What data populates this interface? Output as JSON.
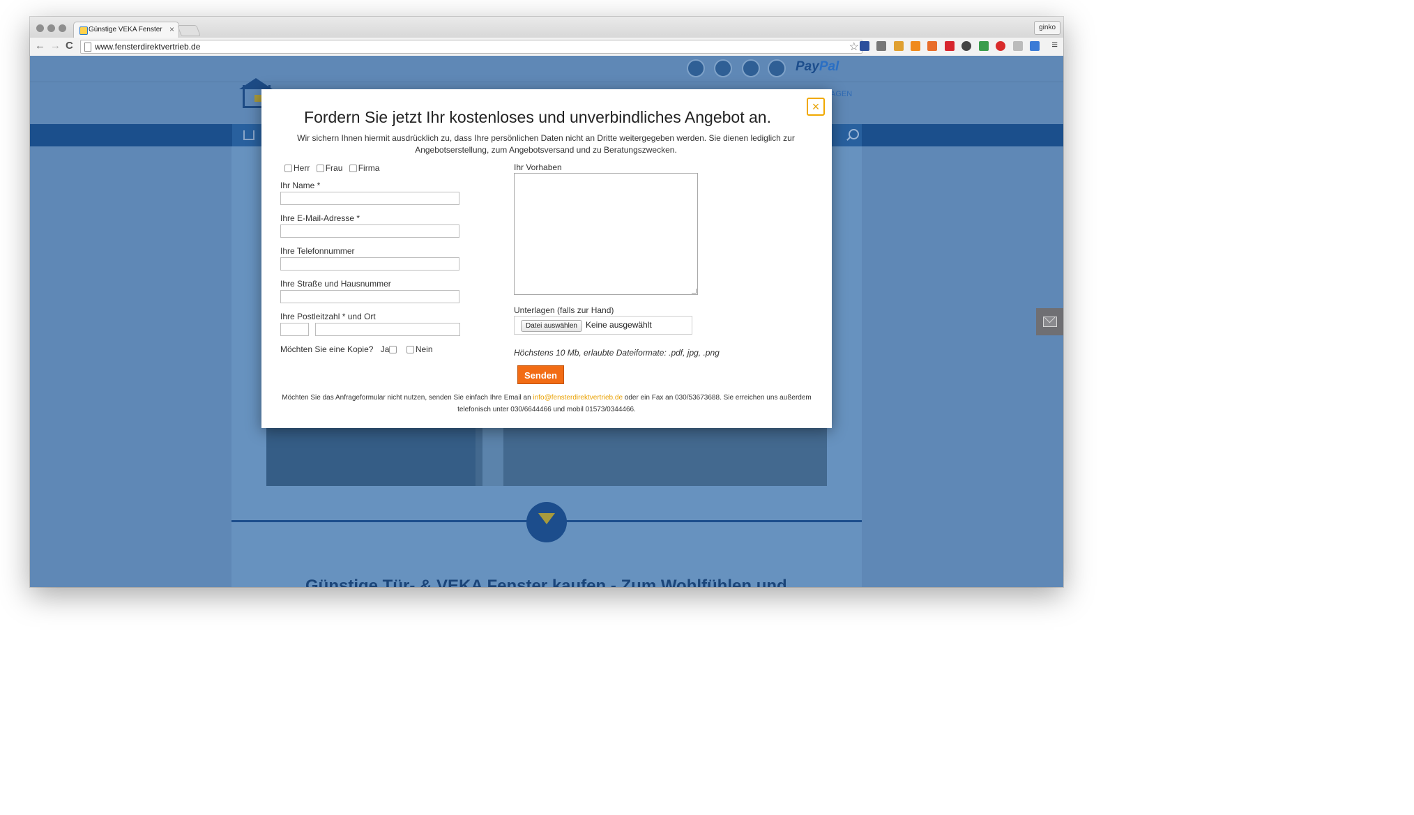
{
  "browser": {
    "tab_title": "Günstige VEKA Fenster ka",
    "tab_close": "×",
    "profile": "ginko",
    "url": "www.fensterdirektvertrieb.de",
    "back": "←",
    "forward": "→",
    "reload": "C",
    "bookmark_star": "☆",
    "menu": "≡"
  },
  "site": {
    "paypal_pay": "Pay",
    "paypal_pal": "Pal",
    "nav_right": "AGEN",
    "headline": "Günstige Tür- & VEKA Fenster kaufen - Zum Wohlfühlen und"
  },
  "modal": {
    "close": "×",
    "title": "Fordern Sie jetzt Ihr kostenloses und unverbindliches Angebot an.",
    "intro": "Wir sichern Ihnen hiermit ausdrücklich zu, dass Ihre persönlichen Daten nicht an Dritte weitergegeben werden. Sie dienen lediglich zur Angebotserstellung, zum Angebotsversand und zu Beratungszwecken.",
    "salutations": [
      "Herr",
      "Frau",
      "Firma"
    ],
    "labels": {
      "name": "Ihr Name *",
      "email": "Ihre E-Mail-Adresse *",
      "phone": "Ihre Telefonnummer",
      "street": "Ihre Straße und Hausnummer",
      "zip_city": "Ihre Postleitzahl * und Ort",
      "copy": "Möchten Sie eine Kopie?",
      "copy_yes": "Ja",
      "copy_no": "Nein",
      "project": "Ihr Vorhaben",
      "documents": "Unterlagen (falls zur Hand)"
    },
    "file_button": "Datei auswählen",
    "file_status": "Keine ausgewählt",
    "file_hint": "Höchstens 10 Mb, erlaubte Dateiformate: .pdf, jpg, .png",
    "send": "Senden",
    "footer_before": "Möchten Sie das Anfrageformular nicht nutzen, senden Sie einfach Ihre Email an ",
    "footer_email": "info@fensterdirektvertrieb.de",
    "footer_after": " oder ein Fax an 030/53673688. Sie erreichen uns außerdem telefonisch unter 030/6644466 und mobil 01573/0344466."
  },
  "colors": {
    "accent_orange": "#f26c14",
    "close_yellow": "#f0a800",
    "nav_blue": "#1b4f8c"
  }
}
